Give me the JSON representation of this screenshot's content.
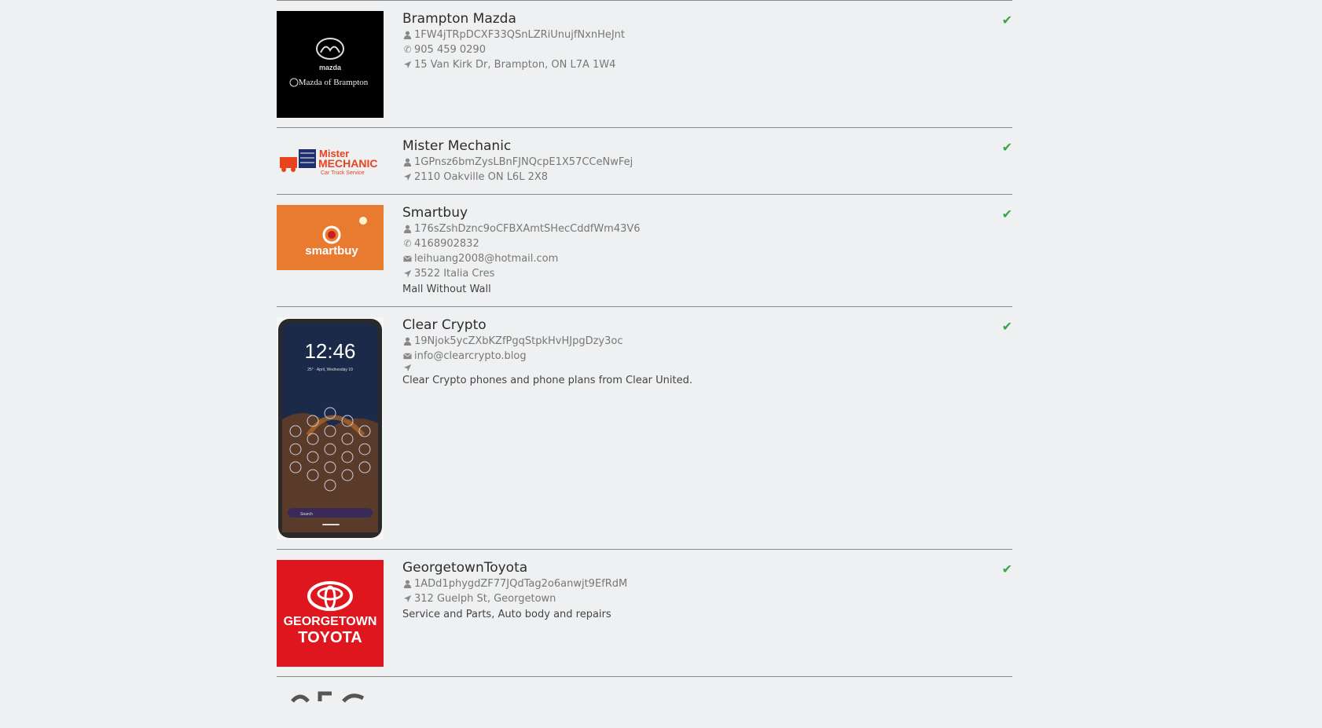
{
  "colors": {
    "verified": "#3aa54a",
    "divider": "#8a8a8a"
  },
  "listings": [
    {
      "name": "Brampton Mazda",
      "address_hash": "1FW4jTRpDCXF33QSnLZRiUnujfNxnHeJnt",
      "phone": "905 459 0290",
      "location": "15 Van Kirk Dr, Brampton, ON L7A 1W4",
      "logo_text": [
        "mazda",
        "Mazda of Brampton"
      ]
    },
    {
      "name": "Mister Mechanic",
      "address_hash": "1GPnsz6bmZysLBnFJNQcpE1X57CCeNwFej",
      "location": "2110 Oakville ON L6L 2X8",
      "logo_text": [
        "Mister",
        "MECHANIC",
        "Car Truck Service"
      ]
    },
    {
      "name": "Smartbuy",
      "address_hash": "176sZshDznc9oCFBXAmtSHecCddfWm43V6",
      "phone": "4168902832",
      "email": "leihuang2008@hotmail.com",
      "location": "3522 Italia Cres",
      "description": "Mall Without Wall",
      "logo_text": [
        "smartbuy"
      ]
    },
    {
      "name": "Clear Crypto",
      "address_hash": "19Njok5ycZXbKZfPgqStpkHvHJpgDzy3oc",
      "email": "info@clearcrypto.blog",
      "location": "",
      "description": "Clear Crypto phones and phone plans from Clear United.",
      "logo_text": [
        "12:46",
        "25° · April, Wednesday 19",
        "Search"
      ]
    },
    {
      "name": "GeorgetownToyota",
      "address_hash": "1ADd1phygdZF77JQdTag2o6anwjt9EfRdM",
      "location": "312 Guelph St, Georgetown",
      "description": "Service and Parts, Auto body and repairs",
      "logo_text": [
        "GEORGETOWN",
        "TOYOTA"
      ]
    }
  ]
}
